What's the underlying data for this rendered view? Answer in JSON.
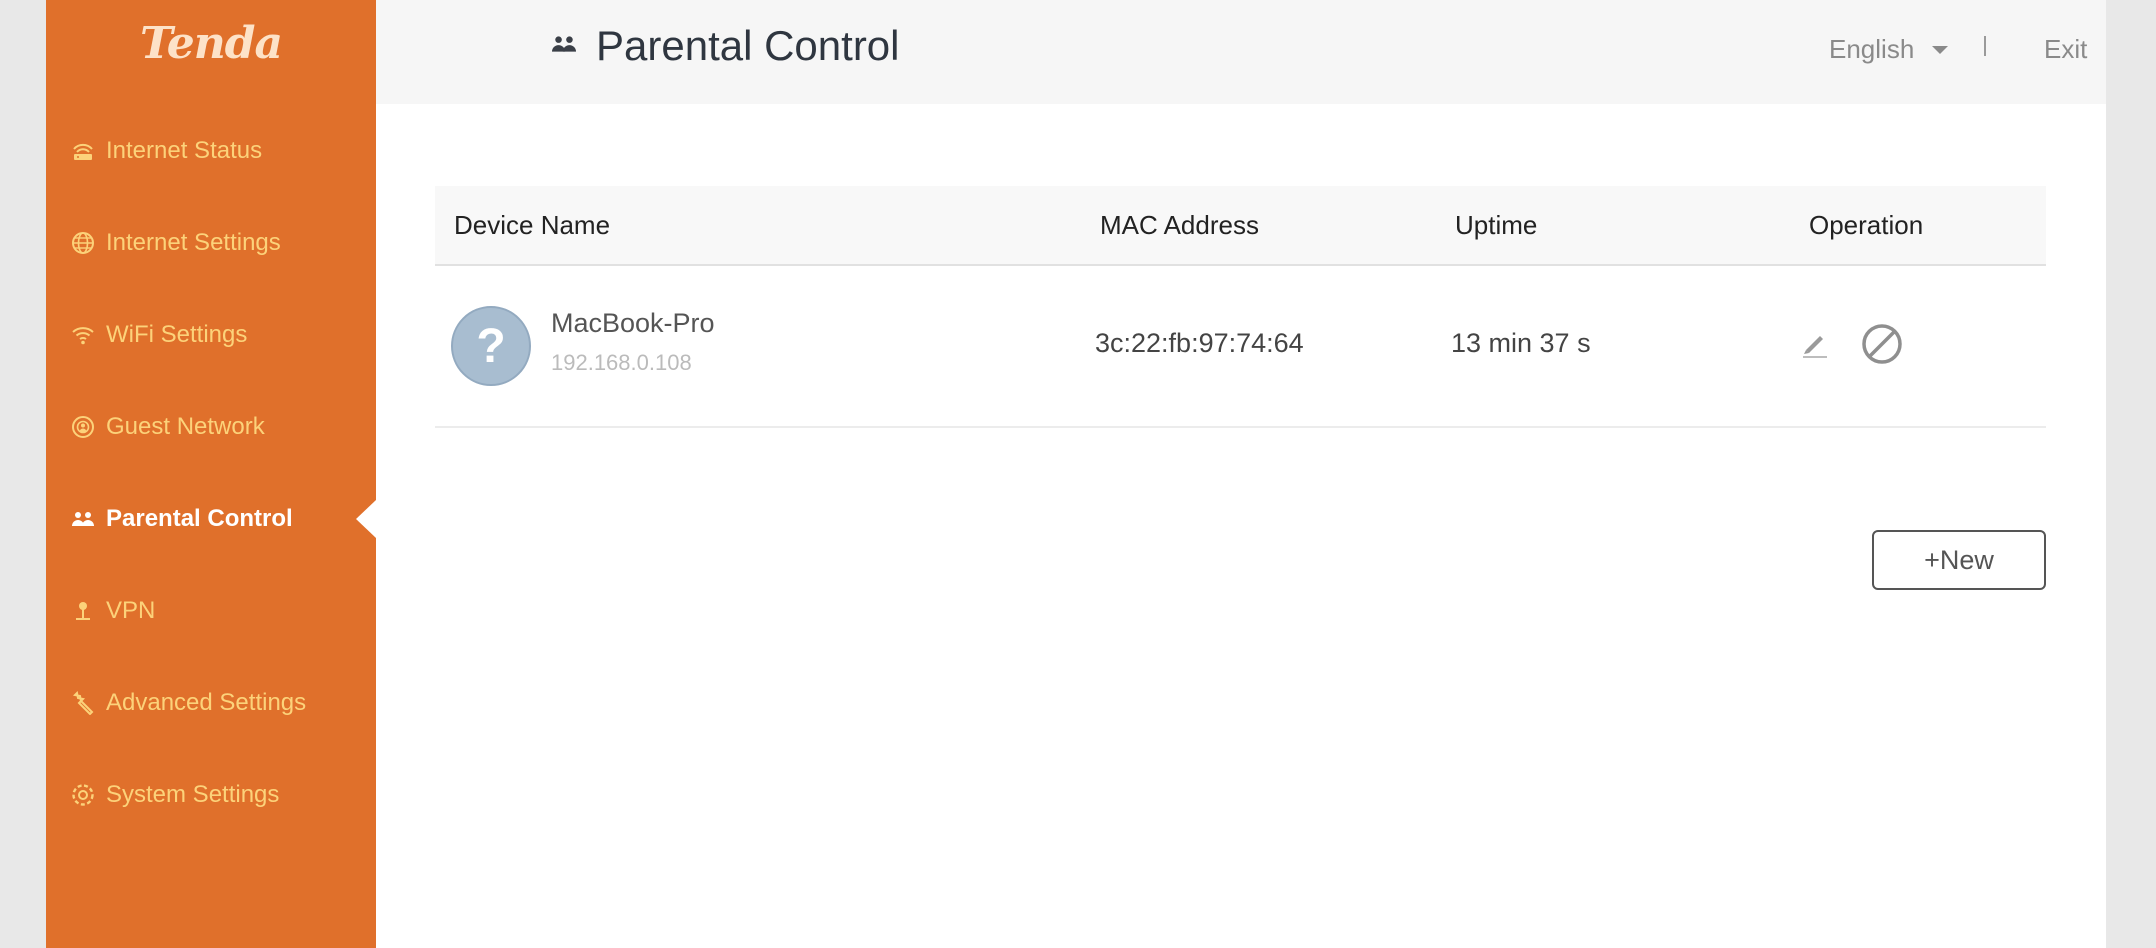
{
  "brand": {
    "logo_text": "Tenda",
    "accent": "#e0702b",
    "nav_text": "#fcd27a",
    "active_text": "#ffffff"
  },
  "sidebar": {
    "items": [
      {
        "label": "Internet Status",
        "icon": "router-icon",
        "active": false
      },
      {
        "label": "Internet Settings",
        "icon": "globe-icon",
        "active": false
      },
      {
        "label": "WiFi Settings",
        "icon": "wifi-icon",
        "active": false
      },
      {
        "label": "Guest Network",
        "icon": "guest-network-icon",
        "active": false
      },
      {
        "label": "Parental Control",
        "icon": "family-icon",
        "active": true
      },
      {
        "label": "VPN",
        "icon": "vpn-icon",
        "active": false
      },
      {
        "label": "Advanced Settings",
        "icon": "wrench-icon",
        "active": false
      },
      {
        "label": "System Settings",
        "icon": "gear-icon",
        "active": false
      }
    ]
  },
  "header": {
    "title": "Parental Control",
    "title_icon": "family-icon",
    "language": "English",
    "separator": "|",
    "exit_label": "Exit"
  },
  "table": {
    "columns": [
      "Device Name",
      "MAC Address",
      "Uptime",
      "Operation"
    ],
    "rows": [
      {
        "avatar_glyph": "?",
        "name": "MacBook-Pro",
        "ip": "192.168.0.108",
        "mac": "3c:22:fb:97:74:64",
        "uptime": "13 min 37 s",
        "operations": [
          "edit-icon",
          "block-icon"
        ]
      }
    ]
  },
  "actions": {
    "new_label": "+New"
  }
}
